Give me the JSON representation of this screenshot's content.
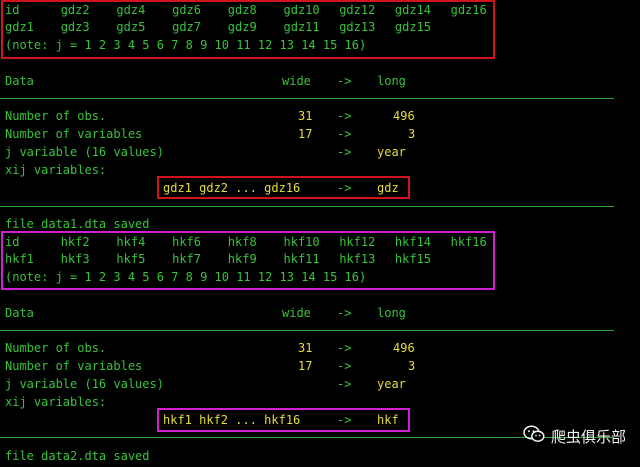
{
  "block1": {
    "varlist_line1": [
      "id",
      "gdz2",
      "gdz4",
      "gdz6",
      "gdz8",
      "gdz10",
      "gdz12",
      "gdz14",
      "gdz16"
    ],
    "varlist_line2": [
      "gdz1",
      "gdz3",
      "gdz5",
      "gdz7",
      "gdz9",
      "gdz11",
      "gdz13",
      "gdz15"
    ],
    "note": "(note: j = 1 2 3 4 5 6 7 8 9 10 11 12 13 14 15 16)",
    "header": {
      "data": "Data",
      "wide": "wide",
      "arrow": "->",
      "long": "long"
    },
    "obs": {
      "label": "Number of obs.",
      "wide": "31",
      "arrow": "->",
      "long": "496"
    },
    "vars": {
      "label": "Number of variables",
      "wide": "17",
      "arrow": "->",
      "long": "3"
    },
    "jvar": {
      "label": "j variable (16 values)",
      "arrow": "->",
      "long": "year"
    },
    "xij": {
      "label": "xij variables:",
      "from": "gdz1 gdz2 ... gdz16",
      "arrow": "->",
      "to": "gdz"
    },
    "saved": "file data1.dta saved"
  },
  "block2": {
    "varlist_line1": [
      "id",
      "hkf2",
      "hkf4",
      "hkf6",
      "hkf8",
      "hkf10",
      "hkf12",
      "hkf14",
      "hkf16"
    ],
    "varlist_line2": [
      "hkf1",
      "hkf3",
      "hkf5",
      "hkf7",
      "hkf9",
      "hkf11",
      "hkf13",
      "hkf15"
    ],
    "note": "(note: j = 1 2 3 4 5 6 7 8 9 10 11 12 13 14 15 16)",
    "header": {
      "data": "Data",
      "wide": "wide",
      "arrow": "->",
      "long": "long"
    },
    "obs": {
      "label": "Number of obs.",
      "wide": "31",
      "arrow": "->",
      "long": "496"
    },
    "vars": {
      "label": "Number of variables",
      "wide": "17",
      "arrow": "->",
      "long": "3"
    },
    "jvar": {
      "label": "j variable (16 values)",
      "arrow": "->",
      "long": "year"
    },
    "xij": {
      "label": "xij variables:",
      "from": "hkf1 hkf2 ... hkf16",
      "arrow": "->",
      "to": "hkf"
    },
    "saved": "file data2.dta saved"
  },
  "watermark": {
    "text": "爬虫俱乐部",
    "icon": "wechat-icon"
  },
  "colors": {
    "background": "#000000",
    "text_green": "#39c23b",
    "value_yellow": "#e6dd3a",
    "box_red": "#d0141e",
    "box_magenta": "#cf1fd0"
  }
}
